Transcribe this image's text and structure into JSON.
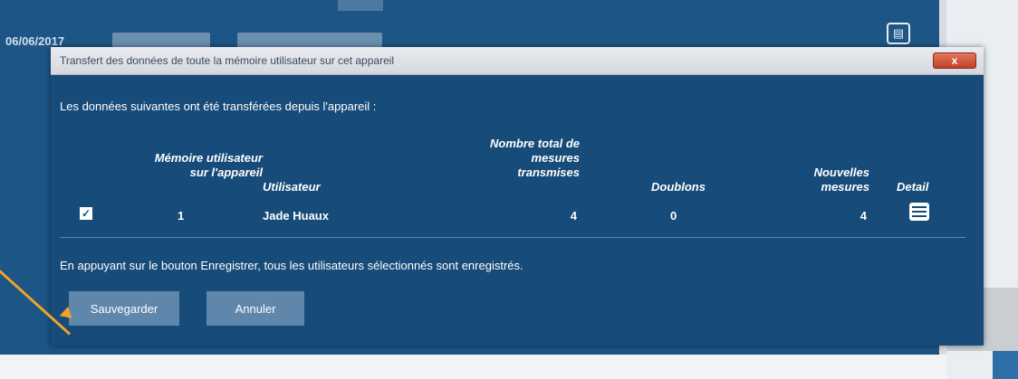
{
  "background": {
    "date": "06/06/2017"
  },
  "dialog": {
    "title": "Transfert des données de toute la mémoire utilisateur sur cet appareil",
    "close_label": "x",
    "intro": "Les données suivantes ont été transférées depuis l'appareil :",
    "columns": {
      "memory": "Mémoire utilisateur\nsur l'appareil",
      "user": "Utilisateur",
      "total": "Nombre total de\nmesures\ntransmises",
      "duplicates": "Doublons",
      "new": "Nouvelles\nmesures",
      "detail": "Detail"
    },
    "rows": [
      {
        "checked": true,
        "check_glyph": "✓",
        "memory": "1",
        "user": "Jade Huaux",
        "total": "4",
        "duplicates": "0",
        "new": "4"
      }
    ],
    "notice": "En appuyant sur le bouton Enregistrer, tous les utilisateurs sélectionnés sont enregistrés.",
    "save_label": "Sauvegarder",
    "cancel_label": "Annuler"
  },
  "colors": {
    "app_background": "#1d5586",
    "dialog_background": "#174b79",
    "button": "#5f86ab",
    "close_button": "#c0412a",
    "annotation_arrow": "#f0a22a"
  },
  "icons": {
    "print": "print-icon",
    "detail": "list-detail-icon",
    "close": "close-icon"
  }
}
